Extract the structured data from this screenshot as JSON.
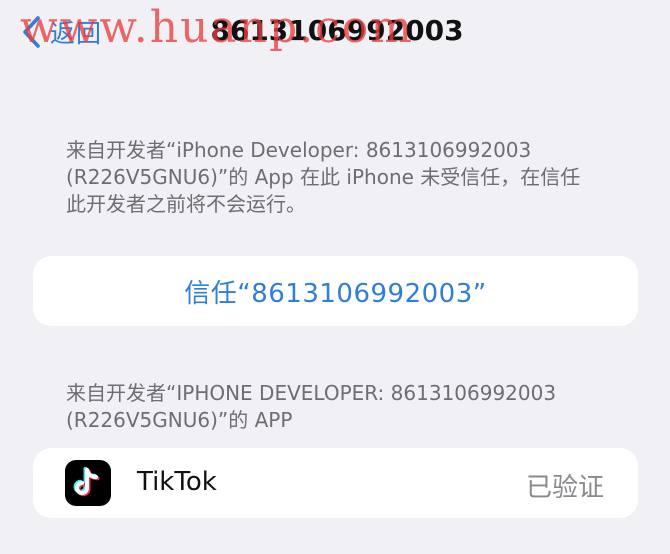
{
  "nav": {
    "back_label": "返回",
    "title": "8613106992003"
  },
  "watermark": "www.huanp.com",
  "developer_note": {
    "line1": "来自开发者“iPhone Developer: 8613106992003",
    "line2": "(R226V5GNU6)”的 App 在此 iPhone 未受信任，在信任",
    "line3": "此开发者之前将不会运行。"
  },
  "trust_button": {
    "label": "信任“8613106992003”"
  },
  "apps_section": {
    "header_line1": "来自开发者“IPHONE DEVELOPER: 8613106992003",
    "header_line2": "(R226V5GNU6)”的 APP"
  },
  "apps": [
    {
      "icon": "tiktok-logo-icon",
      "name": "TikTok",
      "status": "已验证"
    }
  ],
  "colors": {
    "background": "#f1f1f5",
    "accent": "#2f7ed8",
    "secondary_text": "#6d6d72",
    "status_text": "#8a8a8e",
    "watermark": "#e83e3e"
  }
}
